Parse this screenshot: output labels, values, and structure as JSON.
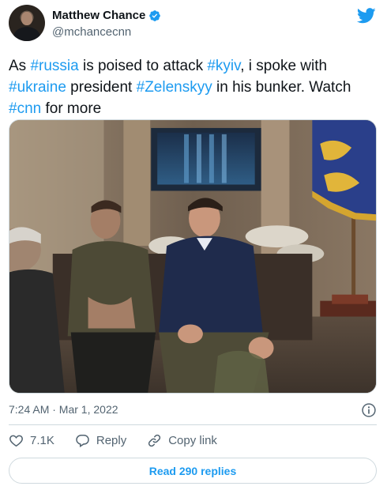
{
  "author": {
    "display_name": "Matthew Chance",
    "handle": "@mchancecnn"
  },
  "tweet": {
    "segments": [
      {
        "text": "As ",
        "tag": false
      },
      {
        "text": "#russia",
        "tag": true
      },
      {
        "text": " is poised to attack ",
        "tag": false
      },
      {
        "text": "#kyiv",
        "tag": true
      },
      {
        "text": ", i spoke with ",
        "tag": false
      },
      {
        "text": "#ukraine",
        "tag": true
      },
      {
        "text": " president ",
        "tag": false
      },
      {
        "text": "#Zelenskyy",
        "tag": true
      },
      {
        "text": " in his bunker. Watch ",
        "tag": false
      },
      {
        "text": "#cnn",
        "tag": true
      },
      {
        "text": " for more",
        "tag": false
      }
    ]
  },
  "meta": {
    "timestamp": "7:24 AM · Mar 1, 2022"
  },
  "actions": {
    "like_count": "7.1K",
    "reply_label": "Reply",
    "copy_link_label": "Copy link"
  },
  "read_replies_label": "Read 290 replies",
  "colors": {
    "accent": "#1d9bf0",
    "text": "#0f1419",
    "muted": "#536471",
    "border": "#cfd9de"
  }
}
